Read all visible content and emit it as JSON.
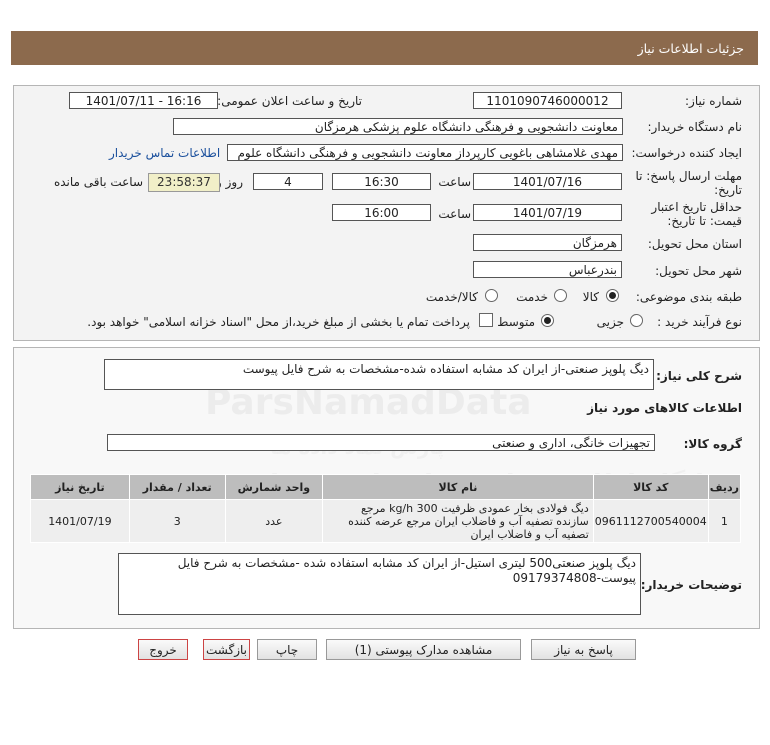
{
  "header": {
    "title": "جزئیات اطلاعات نیاز"
  },
  "need_info": {
    "need_number_label": "شماره نیاز:",
    "need_number": "1101090746000012",
    "announce_label": "تاریخ و ساعت اعلان عمومی:",
    "announce_value": "1401/07/11 - 16:16",
    "buyer_label": "نام دستگاه خریدار:",
    "buyer_value": "معاونت دانشجویی و فرهنگی دانشگاه علوم پزشکی هرمزگان",
    "creator_label": "ایجاد کننده درخواست:",
    "creator_value": "مهدی غلامشاهی باغویی کارپرداز معاونت دانشجویی و فرهنگی دانشگاه علوم",
    "contact_link": "اطلاعات تماس خریدار",
    "deadline_label_1": "مهلت ارسال پاسخ: تا",
    "deadline_label_2": "تاریخ:",
    "deadline_date": "1401/07/16",
    "time_label": "ساعت",
    "deadline_time": "16:30",
    "days_value": "4",
    "days_label": "روز و",
    "remaining_time": "23:58:37",
    "remaining_label": "ساعت باقی مانده",
    "validity_label_1": "حداقل تاریخ اعتبار",
    "validity_label_2": "قیمت: تا تاریخ:",
    "validity_date": "1401/07/19",
    "validity_time_label": "ساعت",
    "validity_time": "16:00",
    "province_label": "استان محل تحویل:",
    "province_value": "هرمزگان",
    "city_label": "شهر محل تحویل:",
    "city_value": "بندرعباس",
    "category_label": "طبقه بندی موضوعی:",
    "category_options": [
      "کالا",
      "خدمت",
      "کالا/خدمت"
    ],
    "category_selected": "کالا",
    "process_label": "نوع فرآیند خرید :",
    "process_options": [
      "جزیی",
      "متوسط"
    ],
    "process_selected": "متوسط",
    "payment_note": "پرداخت تمام یا بخشی از مبلغ خرید،از محل \"اسناد خزانه اسلامی\" خواهد بود."
  },
  "description": {
    "general_label": "شرح کلی نیاز:",
    "general_value": "دیگ پلوپز صنعتی-از ایران کد مشابه استفاده شده-مشخصات به شرح فایل پیوست",
    "goods_info_title": "اطلاعات کالاهای مورد نیاز",
    "group_label": "گروه کالا:",
    "group_value": "تجهیزات خانگی، اداری و صنعتی"
  },
  "table": {
    "headers": [
      "ردیف",
      "کد کالا",
      "نام کالا",
      "واحد شمارش",
      "تعداد / مقدار",
      "تاریخ نیاز"
    ],
    "rows": [
      {
        "index": "1",
        "code": "0961112700540004",
        "name": "دیگ فولادی بخار عمودی ظرفیت 300 kg/h مرجع سازنده تصفیه آب و فاضلاب ایران مرجع عرضه کننده تصفیه آب و فاضلاب ایران",
        "unit": "عدد",
        "qty": "3",
        "date": "1401/07/19"
      }
    ]
  },
  "buyer_notes": {
    "label": "توضیحات خریدار:",
    "value": "دیگ پلوپز صنعتی500 لیتری استیل-از ایران کد مشابه استفاده شده -مشخصات به شرح فایل پیوست-09179374808"
  },
  "buttons": {
    "reply": "پاسخ به نیاز",
    "attachments": "مشاهده مدارک پیوستی (1)",
    "print": "چاپ",
    "back": "بازگشت",
    "exit": "خروج"
  },
  "watermark": {
    "brand": "ParsNamadData",
    "line1": "پایگاه اطلاع رسانی مناقصات و مزایده",
    "line2": "پارس نماد داده ها",
    "phone": "۰۲۱ - ۸۸۳۴۹۶۷۰"
  }
}
